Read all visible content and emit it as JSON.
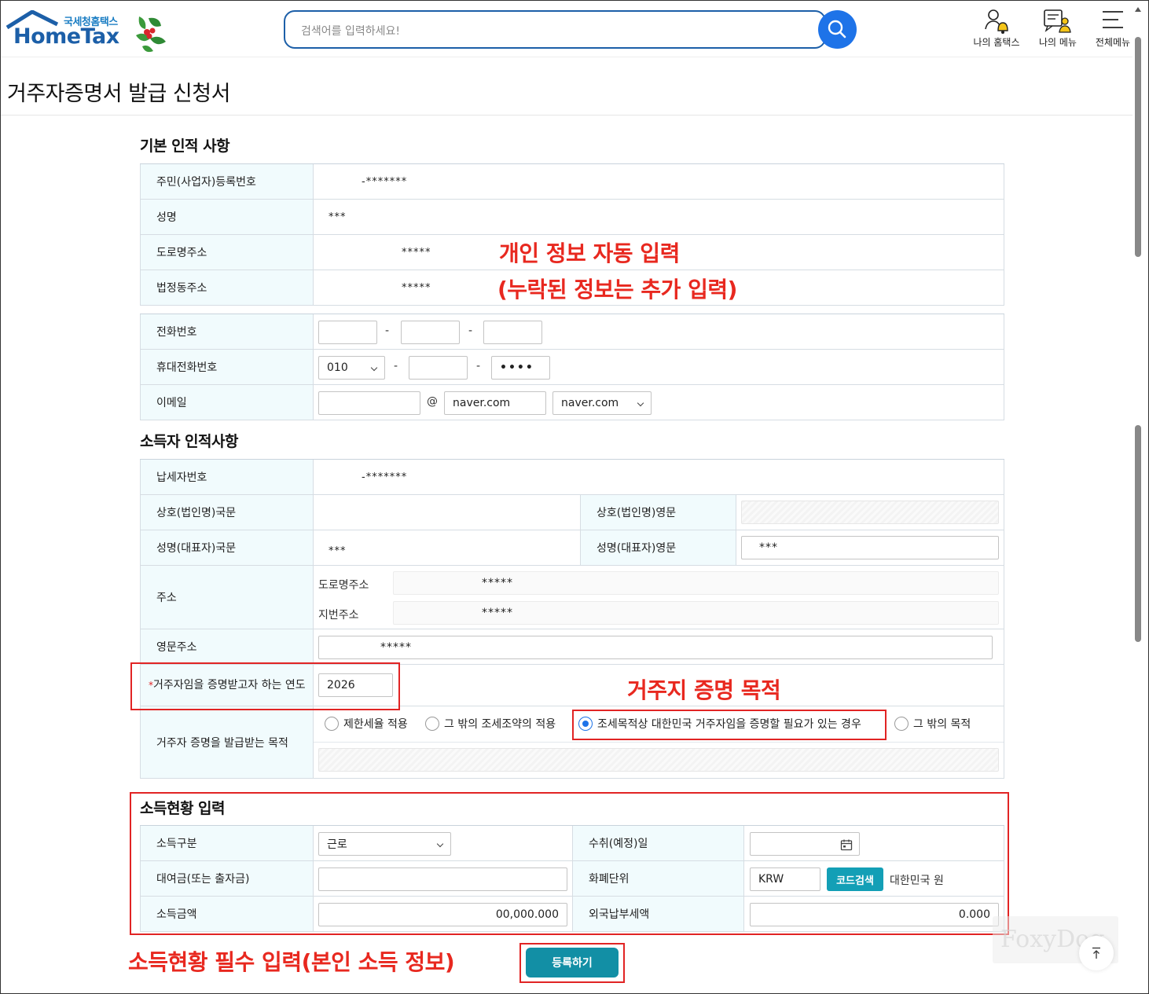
{
  "header": {
    "logo_sub": "국세청홈택스",
    "logo_main": "HomeTax",
    "search_placeholder": "검색어를 입력하세요!",
    "nav": [
      {
        "label": "나의 홈택스",
        "icon": "user-bell-icon"
      },
      {
        "label": "나의 메뉴",
        "icon": "menu-user-icon"
      },
      {
        "label": "전체메뉴",
        "icon": "hamburger-icon"
      }
    ]
  },
  "page_title": "거주자증명서 발급 신청서",
  "basic": {
    "title": "기본 인적 사항",
    "rows": [
      {
        "label": "주민(사업자)등록번호",
        "value": "-*******"
      },
      {
        "label": "성명",
        "value": "***"
      },
      {
        "label": "도로명주소",
        "value": "*****"
      },
      {
        "label": "법정동주소",
        "value": "*****"
      }
    ],
    "phone_label": "전화번호",
    "mobile_label": "휴대전화번호",
    "mobile_prefix": "010",
    "mobile_last": "••••",
    "email_label": "이메일",
    "email_at": "@",
    "email_domain": "naver.com",
    "email_domain_select": "naver.com",
    "dash": "-"
  },
  "earner": {
    "title": "소득자 인적사항",
    "taxpayer_label": "납세자번호",
    "taxpayer_value": "-*******",
    "corp_kr_label": "상호(법인명)국문",
    "corp_en_label": "상호(법인명)영문",
    "name_kr_label": "성명(대표자)국문",
    "name_kr_value": "***",
    "name_en_label": "성명(대표자)영문",
    "name_en_value": "***",
    "addr_label": "주소",
    "road_label": "도로명주소",
    "road_value": "*****",
    "lot_label": "지번주소",
    "lot_value": "*****",
    "eng_addr_label": "영문주소",
    "eng_addr_value": "*****",
    "year_required": "*",
    "year_label": "거주자임을 증명받고자 하는 연도",
    "year_value": "2026",
    "purpose_label": "거주자 증명을 발급받는 목적",
    "purposes": [
      {
        "label": "제한세율 적용",
        "selected": false
      },
      {
        "label": "그 밖의 조세조약의 적용",
        "selected": false
      },
      {
        "label": "조세목적상 대한민국 거주자임을 증명할 필요가 있는 경우",
        "selected": true
      },
      {
        "label": "그 밖의 목적",
        "selected": false
      }
    ]
  },
  "income": {
    "title": "소득현황 입력",
    "type_label": "소득구분",
    "type_value": "근로",
    "date_label": "수취(예정)일",
    "loan_label": "대여금(또는 출자금)",
    "currency_label": "화폐단위",
    "currency_value": "KRW",
    "code_search": "코드검색",
    "currency_name": "대한민국 원",
    "amount_label": "소득금액",
    "amount_value": "00,000.000",
    "foreign_tax_label": "외국납부세액",
    "foreign_tax_value": "0.000"
  },
  "register_button": "등록하기",
  "annotations": {
    "auto_fill_1": "개인 정보 자동 입력",
    "auto_fill_2": "(누락된 정보는 추가 입력)",
    "purpose": "거주지 증명 목적",
    "income_required": "소득현황 필수 입력(본인 소득 정보)"
  },
  "watermark": "FoxyDog",
  "colors": {
    "brand_blue": "#1c5fa8",
    "search_button": "#1e73e8",
    "header_cell": "#f1fbfd",
    "teal_button": "#128fa5",
    "annotation_red": "#e8281f"
  }
}
